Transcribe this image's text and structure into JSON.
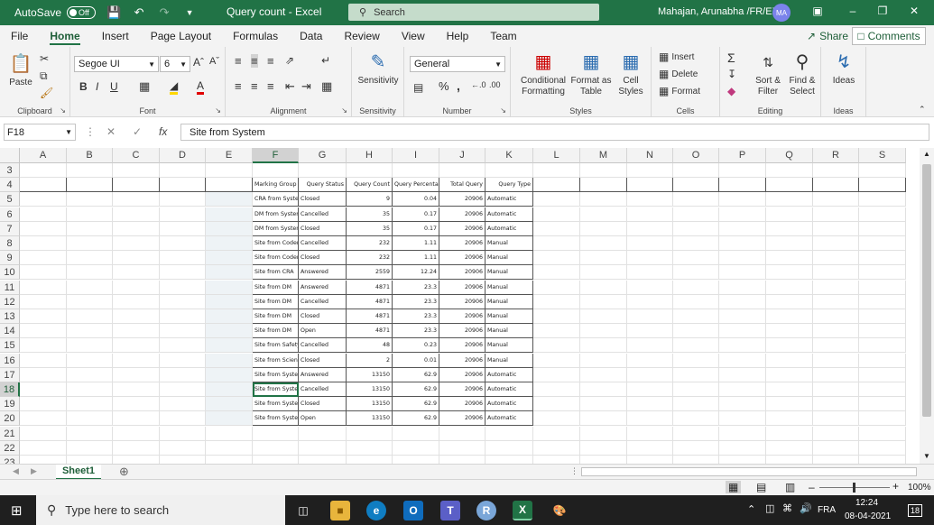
{
  "titlebar": {
    "autosave": "AutoSave",
    "toggle": "Off",
    "title": "Query count  -  Excel",
    "search": "Search",
    "user": "Mahajan, Arunabha /FR/EXT",
    "initials": "MA"
  },
  "menu": {
    "tabs": [
      "File",
      "Home",
      "Insert",
      "Page Layout",
      "Formulas",
      "Data",
      "Review",
      "View",
      "Help",
      "Team"
    ],
    "share": "Share",
    "comments": "Comments"
  },
  "ribbon": {
    "clipboard": {
      "paste": "Paste",
      "label": "Clipboard"
    },
    "font": {
      "name": "Segoe UI",
      "size": "6",
      "label": "Font"
    },
    "alignment": {
      "label": "Alignment"
    },
    "sensitivity": {
      "button": "Sensitivity",
      "label": "Sensitivity"
    },
    "number": {
      "format": "General",
      "label": "Number"
    },
    "styles": {
      "cond1": "Conditional",
      "cond2": "Formatting",
      "fmt1": "Format as",
      "fmt2": "Table",
      "cell1": "Cell",
      "cell2": "Styles",
      "label": "Styles"
    },
    "cells": {
      "insert": "Insert",
      "delete": "Delete",
      "format": "Format",
      "label": "Cells"
    },
    "editing": {
      "sort1": "Sort &",
      "sort2": "Filter",
      "find1": "Find &",
      "find2": "Select",
      "label": "Editing"
    },
    "ideas": {
      "button": "Ideas",
      "label": "Ideas"
    }
  },
  "formula": {
    "namebox": "F18",
    "content": "Site from System"
  },
  "columns": [
    "A",
    "B",
    "C",
    "D",
    "E",
    "F",
    "G",
    "H",
    "I",
    "J",
    "K",
    "L",
    "M",
    "N",
    "O",
    "P",
    "Q",
    "R",
    "S"
  ],
  "rows": [
    "3",
    "4",
    "5",
    "6",
    "7",
    "8",
    "9",
    "10",
    "11",
    "12",
    "13",
    "14",
    "15",
    "16",
    "17",
    "18",
    "19",
    "20",
    "21",
    "22",
    "23"
  ],
  "table": {
    "headers": [
      "Marking Group",
      "Query Status",
      "Query Count",
      "Query Percentage",
      "Total Query",
      "Query Type"
    ],
    "data": [
      [
        "CRA from System",
        "Closed",
        "9",
        "0.04",
        "20906",
        "Automatic"
      ],
      [
        "DM from System",
        "Cancelled",
        "35",
        "0.17",
        "20906",
        "Automatic"
      ],
      [
        "DM from System",
        "Closed",
        "35",
        "0.17",
        "20906",
        "Automatic"
      ],
      [
        "Site from Coder",
        "Cancelled",
        "232",
        "1.11",
        "20906",
        "Manual"
      ],
      [
        "Site from Coder",
        "Closed",
        "232",
        "1.11",
        "20906",
        "Manual"
      ],
      [
        "Site from CRA",
        "Answered",
        "2559",
        "12.24",
        "20906",
        "Manual"
      ],
      [
        "Site from DM",
        "Answered",
        "4871",
        "23.3",
        "20906",
        "Manual"
      ],
      [
        "Site from DM",
        "Cancelled",
        "4871",
        "23.3",
        "20906",
        "Manual"
      ],
      [
        "Site from DM",
        "Closed",
        "4871",
        "23.3",
        "20906",
        "Manual"
      ],
      [
        "Site from DM",
        "Open",
        "4871",
        "23.3",
        "20906",
        "Manual"
      ],
      [
        "Site from Safety",
        "Cancelled",
        "48",
        "0.23",
        "20906",
        "Manual"
      ],
      [
        "Site from Scientific",
        "Closed",
        "2",
        "0.01",
        "20906",
        "Manual"
      ],
      [
        "Site from System",
        "Answered",
        "13150",
        "62.9",
        "20906",
        "Automatic"
      ],
      [
        "Site from System",
        "Cancelled",
        "13150",
        "62.9",
        "20906",
        "Automatic"
      ],
      [
        "Site from System",
        "Closed",
        "13150",
        "62.9",
        "20906",
        "Automatic"
      ],
      [
        "Site from System",
        "Open",
        "13150",
        "62.9",
        "20906",
        "Automatic"
      ]
    ]
  },
  "sheet": {
    "tab": "Sheet1"
  },
  "status": {
    "zoom": "100%"
  },
  "taskbar": {
    "search": "Type here to search",
    "lang": "FRA",
    "time": "12:24",
    "date": "08-04-2021",
    "notif": "18"
  }
}
